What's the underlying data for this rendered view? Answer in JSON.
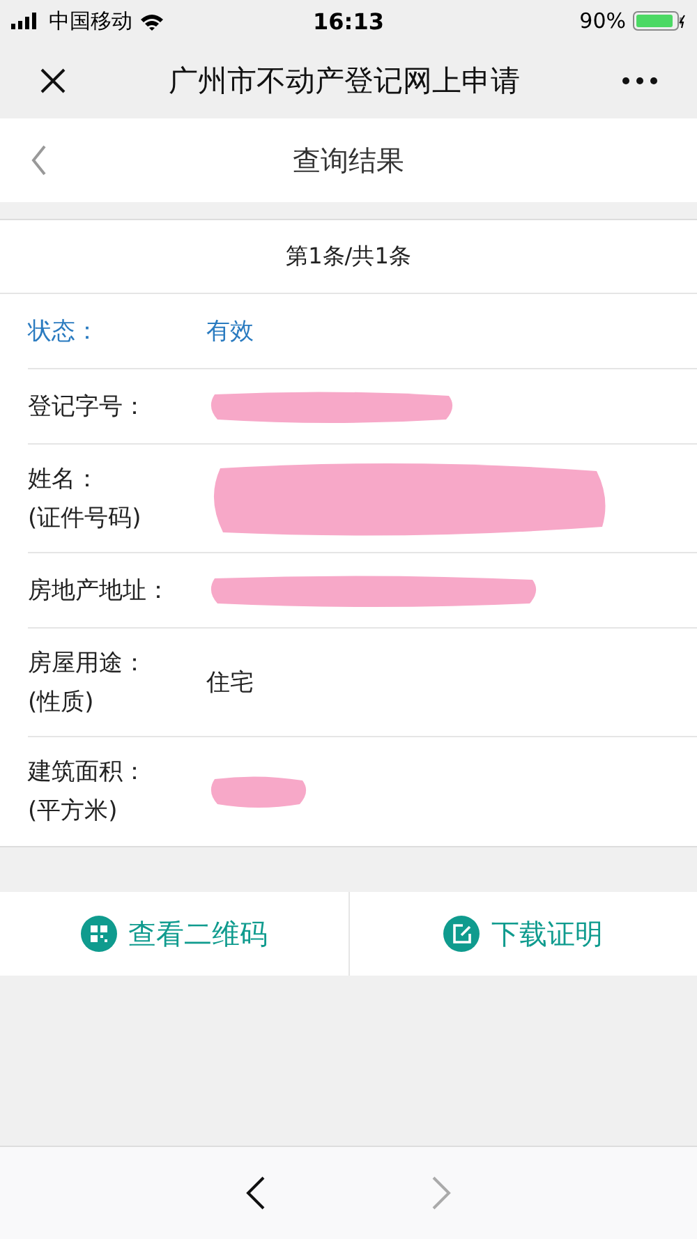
{
  "status_bar": {
    "carrier": "中国移动",
    "time": "16:13",
    "battery": "90%"
  },
  "nav_bar": {
    "title": "广州市不动产登记网上申请"
  },
  "header": {
    "title": "查询结果"
  },
  "result": {
    "count": "第1条/共1条",
    "rows": [
      {
        "kind": "status",
        "label": [
          "状态："
        ],
        "value": "有效"
      },
      {
        "kind": "redacted",
        "label": [
          "登记字号："
        ]
      },
      {
        "kind": "redacted",
        "label": [
          "姓名：",
          "(证件号码)"
        ]
      },
      {
        "kind": "redacted",
        "label": [
          "房地产地址："
        ]
      },
      {
        "kind": "text",
        "label": [
          "房屋用途：",
          "(性质)"
        ],
        "value": "住宅"
      },
      {
        "kind": "redacted",
        "label": [
          "建筑面积：",
          "(平方米)"
        ]
      }
    ]
  },
  "actions": [
    {
      "kind": "qr",
      "label": "查看二维码"
    },
    {
      "kind": "edit",
      "label": "下载证明"
    }
  ],
  "toolbar": {
    "back_disabled": false,
    "forward_disabled": true
  }
}
